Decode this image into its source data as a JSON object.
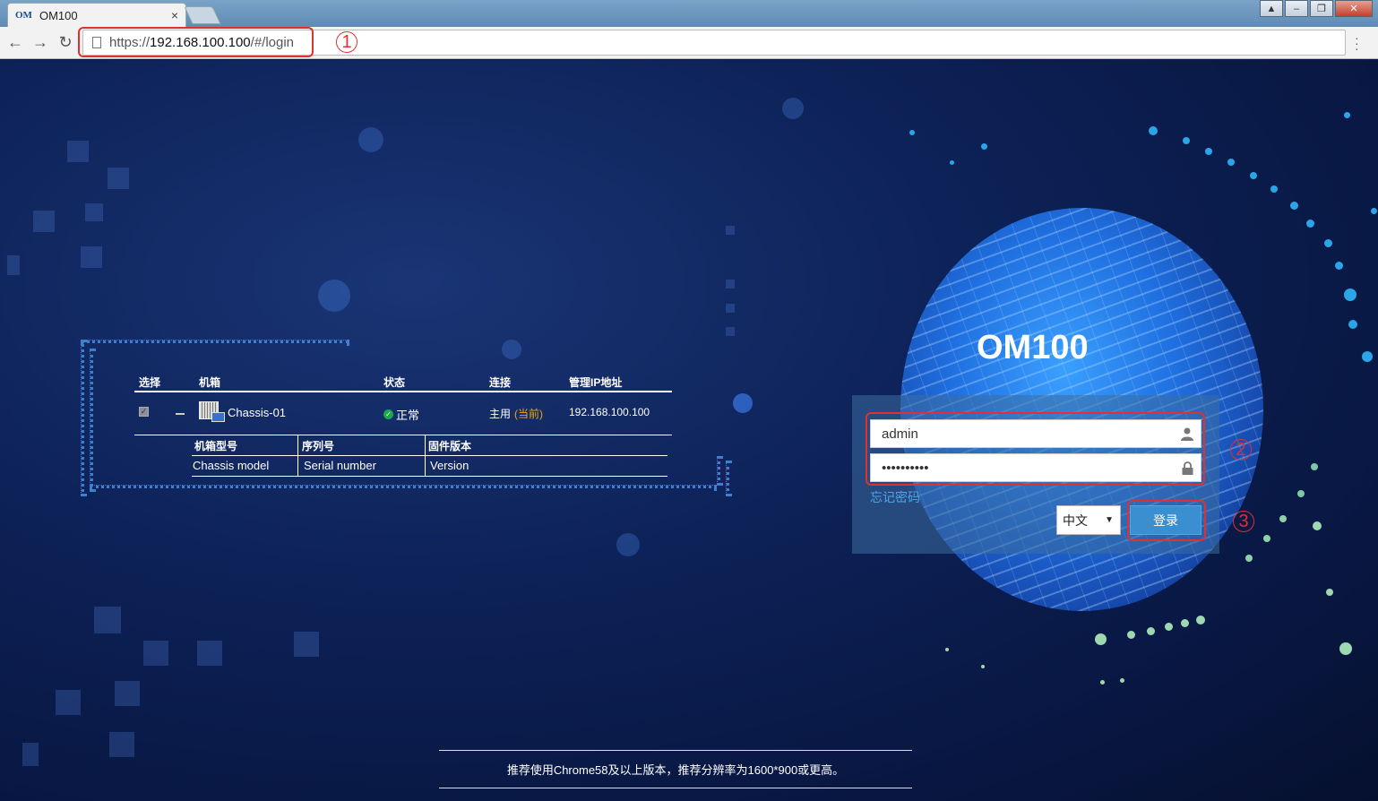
{
  "browser": {
    "tab_logo": "OM",
    "tab_title": "OM100",
    "tab_close": "×",
    "url_prefix": "https://",
    "url_host": "192.168.100.100",
    "url_path": "/#/login",
    "window_buttons": [
      "▲",
      "–",
      "❐",
      "✕"
    ]
  },
  "annotations": [
    "1",
    "2",
    "3"
  ],
  "login": {
    "brand": "OM100",
    "username_value": "admin",
    "password_value": "••••••••••",
    "user_icon": "user-icon",
    "lock_icon": "lock-icon",
    "forgot_password": "忘记密码",
    "language": "中文",
    "login_button": "登录"
  },
  "chassis_table": {
    "headers": [
      "选择",
      "机箱",
      "状态",
      "连接",
      "管理IP地址"
    ],
    "row": {
      "name": "Chassis-01",
      "status": "正常",
      "connection": "主用",
      "connection_current": "(当前)",
      "ip": "192.168.100.100"
    },
    "sub_headers": [
      "机箱型号",
      "序列号",
      "固件版本"
    ],
    "sub_values": [
      "Chassis model",
      "Serial number",
      "Version"
    ]
  },
  "footer": {
    "text": "推荐使用Chrome58及以上版本，推荐分辨率为1600*900或更高。"
  },
  "colors": {
    "annotation_red": "#e03030",
    "login_button": "#3a8fd0",
    "link_blue": "#4ba6e8",
    "current_orange": "#f0a020",
    "status_green": "#1ca84a"
  }
}
